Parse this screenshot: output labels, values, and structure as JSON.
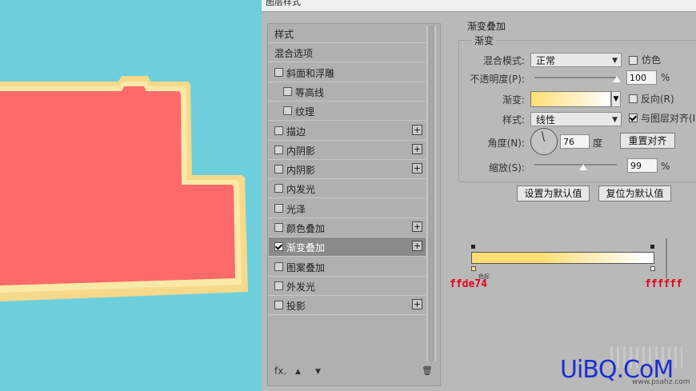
{
  "dialog": {
    "title": "图层样式"
  },
  "styles_list": {
    "items": [
      {
        "label": "样式",
        "checkbox": false,
        "checked": false,
        "plus": false,
        "indent": 0
      },
      {
        "label": "混合选项",
        "checkbox": false,
        "checked": false,
        "plus": false,
        "indent": 0
      },
      {
        "label": "斜面和浮雕",
        "checkbox": true,
        "checked": false,
        "plus": false,
        "indent": 0
      },
      {
        "label": "等高线",
        "checkbox": true,
        "checked": false,
        "plus": false,
        "indent": 1
      },
      {
        "label": "纹理",
        "checkbox": true,
        "checked": false,
        "plus": false,
        "indent": 1
      },
      {
        "label": "描边",
        "checkbox": true,
        "checked": false,
        "plus": true,
        "indent": 0
      },
      {
        "label": "内阴影",
        "checkbox": true,
        "checked": false,
        "plus": true,
        "indent": 0
      },
      {
        "label": "内阴影",
        "checkbox": true,
        "checked": false,
        "plus": true,
        "indent": 0
      },
      {
        "label": "内发光",
        "checkbox": true,
        "checked": false,
        "plus": false,
        "indent": 0
      },
      {
        "label": "光泽",
        "checkbox": true,
        "checked": false,
        "plus": false,
        "indent": 0
      },
      {
        "label": "颜色叠加",
        "checkbox": true,
        "checked": false,
        "plus": true,
        "indent": 0
      },
      {
        "label": "渐变叠加",
        "checkbox": true,
        "checked": true,
        "plus": true,
        "indent": 0,
        "active": true
      },
      {
        "label": "图案叠加",
        "checkbox": true,
        "checked": false,
        "plus": false,
        "indent": 0
      },
      {
        "label": "外发光",
        "checkbox": true,
        "checked": false,
        "plus": false,
        "indent": 0
      },
      {
        "label": "投影",
        "checkbox": true,
        "checked": false,
        "plus": true,
        "indent": 0
      }
    ],
    "plus_glyph": "+",
    "fx_label": "fx.",
    "up_arrow": "▲",
    "down_arrow": "▼",
    "trash_glyph": "🗑"
  },
  "gradient_overlay": {
    "section_title": "渐变叠加",
    "group_title": "渐变",
    "blend_mode_label": "混合模式:",
    "blend_mode_value": "正常",
    "dither_label": "仿色",
    "opacity_label": "不透明度(P):",
    "opacity_value": "100",
    "percent": "%",
    "gradient_label": "渐变:",
    "reverse_label": "反向(R)",
    "style_label": "样式:",
    "style_value": "线性",
    "align_label": "与图层对齐(I)",
    "angle_label": "角度(N):",
    "angle_value": "76",
    "angle_unit": "度",
    "reset_align_button": "重置对齐",
    "scale_label": "缩放(S):",
    "scale_value": "99",
    "set_default_button": "设置为默认值",
    "reset_default_button": "复位为默认值",
    "opacity_pct": 100,
    "scale_pct": 99
  },
  "gradient_editor": {
    "left_color": "#ffde74",
    "right_color": "#ffffff",
    "left_hex_label": "ffde74",
    "right_hex_label": "ffffff",
    "stop_caption": "色标"
  },
  "watermark": {
    "text": "UiBQ.CoM",
    "sub": "www.psahz.com"
  },
  "colors": {
    "canvas_bg": "#6ecfdc",
    "shape_fill": "#fd6a6a",
    "shape_border": "#fce39b"
  }
}
